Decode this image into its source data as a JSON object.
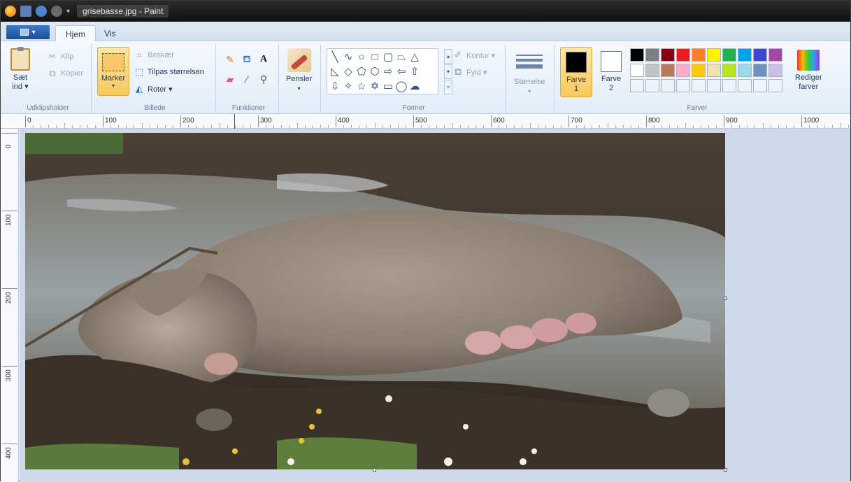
{
  "window": {
    "title": "grisebasse.jpg - Paint"
  },
  "quick_access": {
    "dropdown": "▾"
  },
  "tabs": {
    "file_label": "▾",
    "items": [
      {
        "label": "Hjem"
      },
      {
        "label": "Vis"
      }
    ]
  },
  "ribbon": {
    "clipboard": {
      "paste_label_1": "Sæt",
      "paste_label_2": "ind ▾",
      "cut_label": "Klip",
      "copy_label": "Kopier",
      "group_label": "Udklipsholder"
    },
    "image": {
      "select_label": "Marker",
      "crop_label": "Beskær",
      "resize_label": "Tilpas størrelsen",
      "rotate_label": "Roter ▾",
      "group_label": "Billede"
    },
    "tools": {
      "text_label": "A",
      "group_label": "Funktioner"
    },
    "brushes": {
      "label": "Pensler",
      "arrow": "▾"
    },
    "shapes": {
      "outline_label": "Kontur ▾",
      "fill_label": "Fyld ▾",
      "group_label": "Former"
    },
    "size": {
      "label": "Størrelse",
      "arrow": "▾"
    },
    "colors": {
      "color1_label_1": "Farve",
      "color1_label_2": "1",
      "color2_label_1": "Farve",
      "color2_label_2": "2",
      "edit_label_1": "Rediger",
      "edit_label_2": "farver",
      "group_label": "Farver",
      "color1": "#000000",
      "color2": "#ffffff",
      "palette_row1": [
        "#000000",
        "#7f7f7f",
        "#880015",
        "#ed1c24",
        "#ff7f27",
        "#fff200",
        "#22b14c",
        "#00a2e8",
        "#3f48cc",
        "#a349a4"
      ],
      "palette_row2": [
        "#ffffff",
        "#c3c3c3",
        "#b97a57",
        "#ffaec9",
        "#ffc90e",
        "#efe4b0",
        "#b5e61d",
        "#99d9ea",
        "#7092be",
        "#c8bfe7"
      ]
    }
  },
  "ruler": {
    "horizontal": [
      "0",
      "100",
      "200",
      "300",
      "400",
      "500",
      "600",
      "700",
      "800",
      "900",
      "1000"
    ],
    "vertical": [
      "0",
      "100",
      "200",
      "300",
      "400"
    ]
  }
}
